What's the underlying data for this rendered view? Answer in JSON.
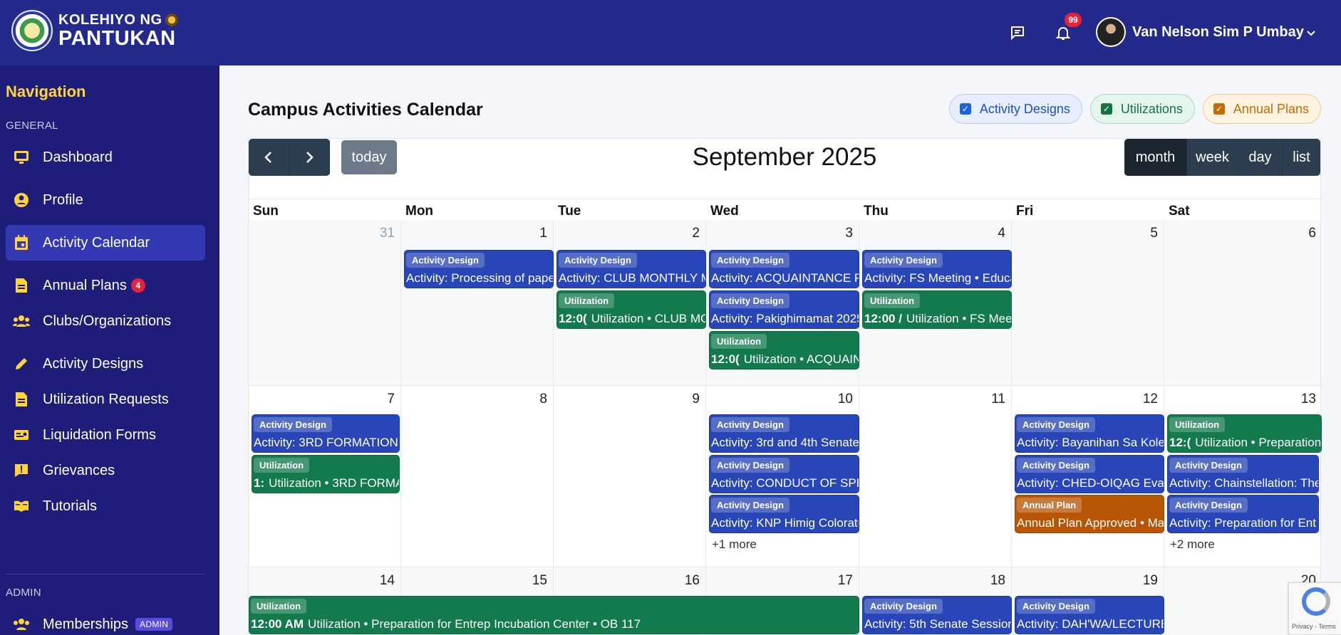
{
  "header": {
    "logo_line1": "KOLEHIYO NG",
    "logo_line2": "PANTUKAN",
    "notifications_count": "99",
    "user_name": "Van Nelson Sim P Umbay"
  },
  "sidebar": {
    "nav_title": "Navigation",
    "section_general": "GENERAL",
    "section_admin": "ADMIN",
    "items": [
      {
        "label": "Dashboard",
        "icon": "monitor-icon"
      },
      {
        "label": "Profile",
        "icon": "user-circle-icon"
      },
      {
        "label": "Activity Calendar",
        "icon": "calendar-icon",
        "active": true
      },
      {
        "label": "Annual Plans",
        "icon": "file-icon",
        "badge": "4"
      },
      {
        "label": "Clubs/Organizations",
        "icon": "users-icon"
      },
      {
        "label": "Activity Designs",
        "icon": "pencil-icon"
      },
      {
        "label": "Utilization Requests",
        "icon": "file-icon"
      },
      {
        "label": "Liquidation Forms",
        "icon": "money-check-icon"
      },
      {
        "label": "Grievances",
        "icon": "exclamation-icon"
      },
      {
        "label": "Tutorials",
        "icon": "book-icon"
      }
    ],
    "admin_items": [
      {
        "label": "Memberships",
        "icon": "users-icon",
        "badge": "ADMIN"
      }
    ]
  },
  "main": {
    "page_title": "Campus Activities Calendar",
    "filters": [
      {
        "label": "Activity Designs",
        "checked": true,
        "color": "#1a64e0"
      },
      {
        "label": "Utilizations",
        "checked": true,
        "color": "#157347"
      },
      {
        "label": "Annual Plans",
        "checked": true,
        "color": "#c56a06"
      }
    ]
  },
  "calendar": {
    "title": "September 2025",
    "today_label": "today",
    "views": [
      "month",
      "week",
      "day",
      "list"
    ],
    "active_view": "month",
    "days_of_week": [
      "Sun",
      "Mon",
      "Tue",
      "Wed",
      "Thu",
      "Fri",
      "Sat"
    ],
    "weeks": [
      {
        "days": [
          "31",
          "1",
          "2",
          "3",
          "4",
          "5",
          "6"
        ]
      },
      {
        "days": [
          "7",
          "8",
          "9",
          "10",
          "11",
          "12",
          "13"
        ]
      },
      {
        "days": [
          "14",
          "15",
          "16",
          "17",
          "18",
          "19",
          "20"
        ]
      }
    ],
    "events": {
      "w1": [
        {
          "tag": "Activity Design",
          "text": "Activity: Processing of pape"
        },
        {
          "tag": "Activity Design",
          "text": "Activity: CLUB MONTHLY M"
        },
        {
          "tag": "Utilization",
          "time": "12:0(",
          "text": "Utilization • CLUB MO"
        },
        {
          "tag": "Activity Design",
          "text": "Activity: ACQUAINTANCE PA"
        },
        {
          "tag": "Activity Design",
          "text": "Activity: Pakighimamat 2025"
        },
        {
          "tag": "Utilization",
          "time": "12:0(",
          "text": "Utilization • ACQUAIN"
        },
        {
          "tag": "Activity Design",
          "text": "Activity: FS Meeting • Educa"
        },
        {
          "tag": "Utilization",
          "time": "12:00 /",
          "text": "Utilization • FS Meet"
        }
      ],
      "w2": [
        {
          "tag": "Activity Design",
          "text": "Activity: 3RD FORMATION -"
        },
        {
          "tag": "Utilization",
          "time": "1:",
          "text": "Utilization • 3RD FORMAT"
        },
        {
          "tag": "Activity Design",
          "text": "Activity: 3rd and 4th Senate"
        },
        {
          "tag": "Activity Design",
          "text": "Activity: CONDUCT OF SPEC"
        },
        {
          "tag": "Activity Design",
          "text": "Activity: KNP Himig Coloratu"
        },
        {
          "tag": "Activity Design",
          "text": "Activity: Bayanihan Sa Koleh"
        },
        {
          "tag": "Activity Design",
          "text": "Activity: CHED-OIQAG Evalu"
        },
        {
          "tag": "Annual Plan",
          "text": "Annual Plan Approved • Ma"
        },
        {
          "tag": "Utilization",
          "time": "12:(",
          "text": "Utilization • Preparation"
        },
        {
          "tag": "Activity Design",
          "text": "Activity: Chainstellation: The"
        },
        {
          "tag": "Activity Design",
          "text": "Activity: Preparation for Ent"
        }
      ],
      "w2_more_wed": "+1 more",
      "w2_more_sat": "+2 more",
      "w3": [
        {
          "tag": "Utilization",
          "time": "12:00 AM",
          "text": "Utilization • Preparation for Entrep Incubation Center • OB 117"
        },
        {
          "tag": "Activity Design",
          "text": "Activity: 5th Senate Session"
        },
        {
          "tag": "Activity Design",
          "text": "Activity: DAH'WA/LECTURE"
        }
      ]
    }
  },
  "recaptcha": {
    "text": "Privacy - Terms"
  }
}
